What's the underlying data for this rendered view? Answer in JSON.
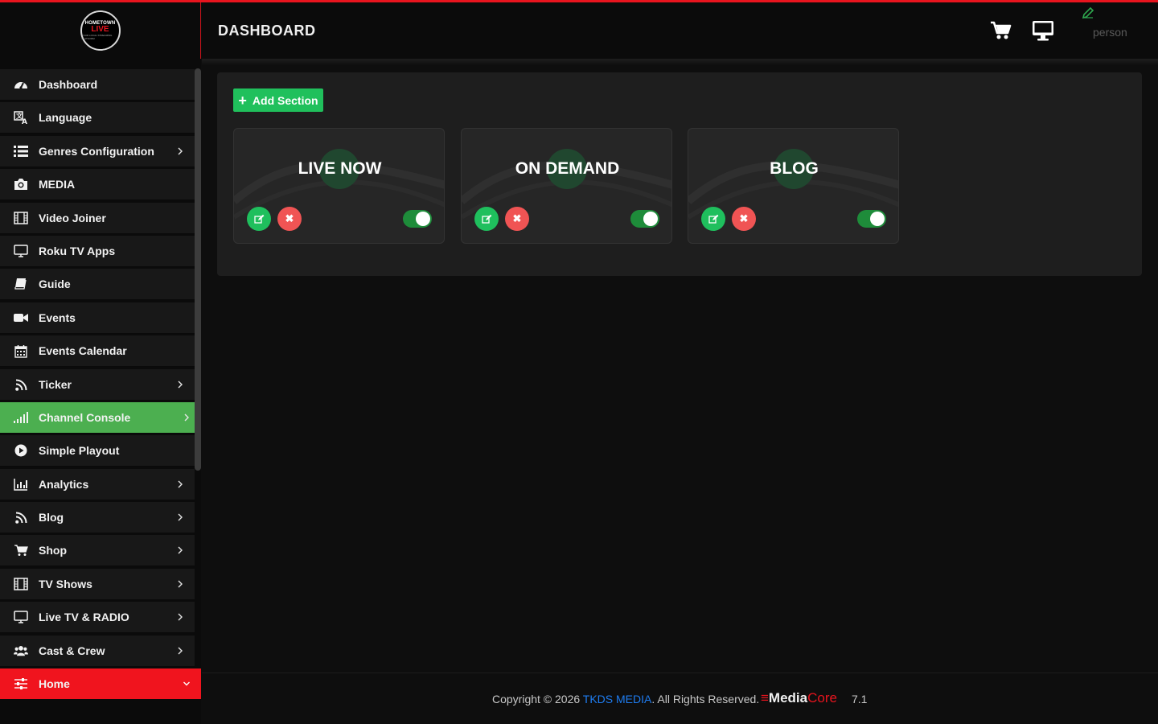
{
  "app": {
    "logo": {
      "line1": "HOMETOWN",
      "line2": "LIVE",
      "line3": "YOUR LOCAL STREAMING PLATFORM"
    },
    "page_title": "DASHBOARD",
    "user_name": "person"
  },
  "icons": {
    "cart": "cart-icon",
    "monitor": "monitor-icon",
    "pen": "pen-icon"
  },
  "sidebar": {
    "items": [
      {
        "label": "Dashboard",
        "icon": "dashboard-icon",
        "chevron": false
      },
      {
        "label": "Language",
        "icon": "language-icon",
        "chevron": false
      },
      {
        "label": "Genres Configuration",
        "icon": "list-icon",
        "chevron": true
      },
      {
        "label": "MEDIA",
        "icon": "camera-icon",
        "chevron": false
      },
      {
        "label": "Video Joiner",
        "icon": "film-icon",
        "chevron": false
      },
      {
        "label": "Roku TV Apps",
        "icon": "tv-icon",
        "chevron": false
      },
      {
        "label": "Guide",
        "icon": "book-icon",
        "chevron": false
      },
      {
        "label": "Events",
        "icon": "video-camera-icon",
        "chevron": false
      },
      {
        "label": "Events Calendar",
        "icon": "calendar-icon",
        "chevron": false
      },
      {
        "label": "Ticker",
        "icon": "rss-icon",
        "chevron": true
      },
      {
        "label": "Channel Console",
        "icon": "signal-icon",
        "chevron": true,
        "active": "green"
      },
      {
        "label": "Simple Playout",
        "icon": "play-circle-icon",
        "chevron": false
      },
      {
        "label": "Analytics",
        "icon": "bar-chart-icon",
        "chevron": true
      },
      {
        "label": "Blog",
        "icon": "rss-icon",
        "chevron": true
      },
      {
        "label": "Shop",
        "icon": "cart-icon",
        "chevron": true
      },
      {
        "label": "TV Shows",
        "icon": "film-icon",
        "chevron": true
      },
      {
        "label": "Live TV & RADIO",
        "icon": "tv-icon",
        "chevron": true
      },
      {
        "label": "Cast & Crew",
        "icon": "users-icon",
        "chevron": true
      },
      {
        "label": "Home",
        "icon": "sliders-icon",
        "chevron": true,
        "active": "red"
      }
    ]
  },
  "main": {
    "add_section_label": "Add Section",
    "sections": [
      {
        "title": "LIVE NOW",
        "enabled": true
      },
      {
        "title": "ON DEMAND",
        "enabled": true
      },
      {
        "title": "BLOG",
        "enabled": true
      }
    ]
  },
  "footer": {
    "copyright_prefix": "Copyright © 2026 ",
    "company": "TKDS MEDIA",
    "copyright_suffix": ". All Rights Reserved.",
    "brand_part1": "Media",
    "brand_part2": "Core",
    "version": "7.1"
  },
  "colors": {
    "accent_red": "#e8141e",
    "accent_green": "#20c05c",
    "active_green": "#4caf50",
    "link_blue": "#1e7cf0"
  }
}
